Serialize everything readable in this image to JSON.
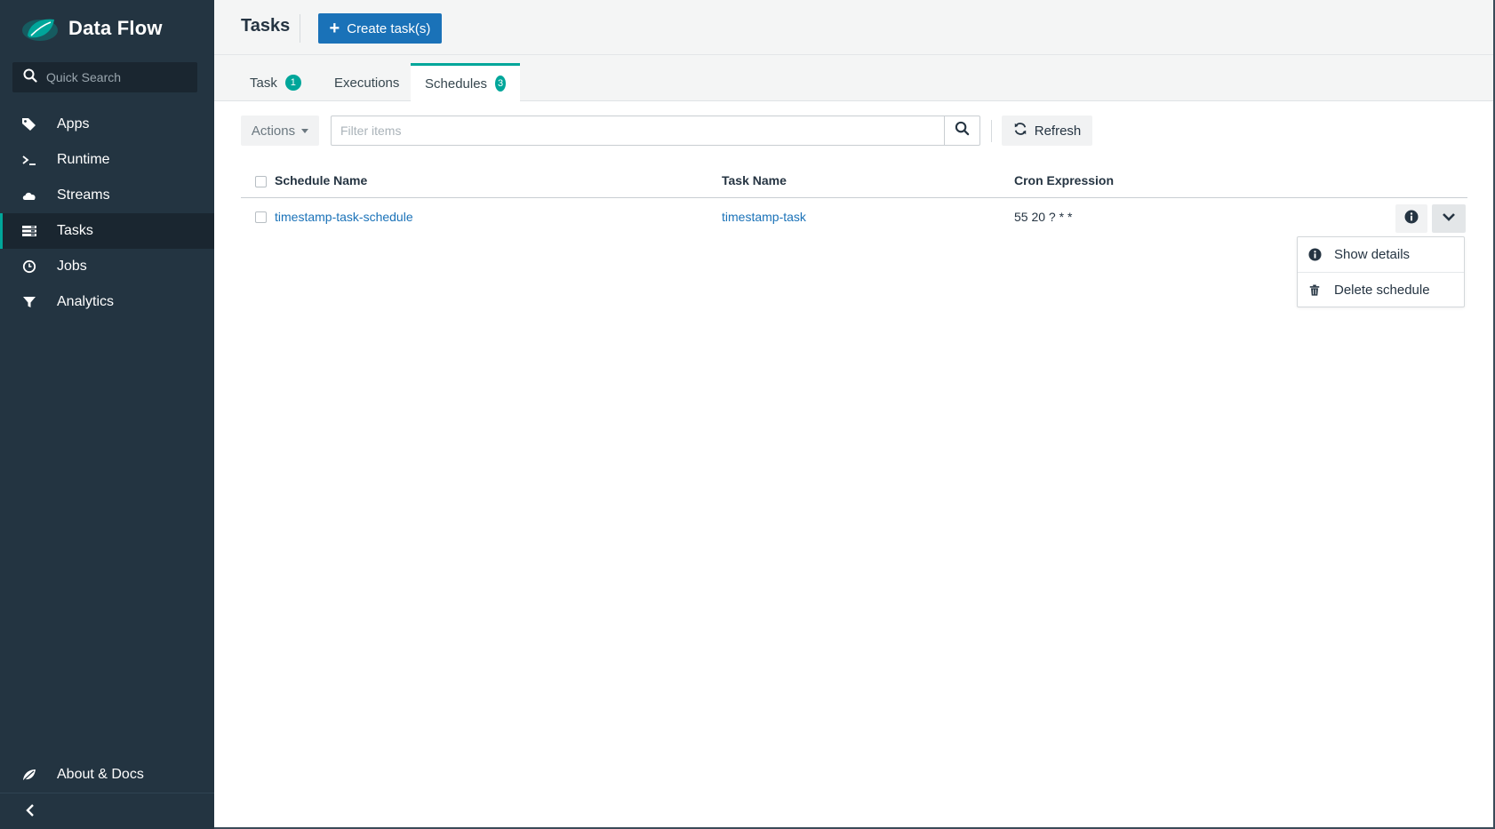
{
  "brand": {
    "name": "Data Flow",
    "logo_icon": "spring-leaf-icon"
  },
  "quick_search": {
    "placeholder": "Quick Search"
  },
  "nav": {
    "items": [
      {
        "label": "Apps",
        "icon": "tags-icon"
      },
      {
        "label": "Runtime",
        "icon": "terminal-icon"
      },
      {
        "label": "Streams",
        "icon": "cloud-icon"
      },
      {
        "label": "Tasks",
        "icon": "tasks-icon",
        "active": true
      },
      {
        "label": "Jobs",
        "icon": "clock-icon"
      },
      {
        "label": "Analytics",
        "icon": "filter-icon"
      }
    ],
    "about_label": "About & Docs"
  },
  "header": {
    "title": "Tasks",
    "create_label": "Create task(s)"
  },
  "tabs": [
    {
      "label": "Task",
      "badge": "1"
    },
    {
      "label": "Executions"
    },
    {
      "label": "Schedules",
      "badge": "3",
      "active": true
    }
  ],
  "toolbar": {
    "actions_label": "Actions",
    "filter_placeholder": "Filter items",
    "refresh_label": "Refresh"
  },
  "table": {
    "columns": [
      "Schedule Name",
      "Task Name",
      "Cron Expression"
    ],
    "rows": [
      {
        "schedule_name": "timestamp-task-schedule",
        "task_name": "timestamp-task",
        "cron_expression": "55 20 ? * *"
      }
    ]
  },
  "row_menu": {
    "items": [
      {
        "label": "Show details",
        "icon": "info-circle-icon"
      },
      {
        "label": "Delete schedule",
        "icon": "trash-icon"
      }
    ]
  },
  "colors": {
    "sidebar_bg": "#233441",
    "sidebar_active_bg": "#1a2630",
    "accent_teal": "#00a69a",
    "primary_blue": "#1a72b8",
    "link_blue": "#1a72b8",
    "header_bg": "#f4f5f5"
  }
}
